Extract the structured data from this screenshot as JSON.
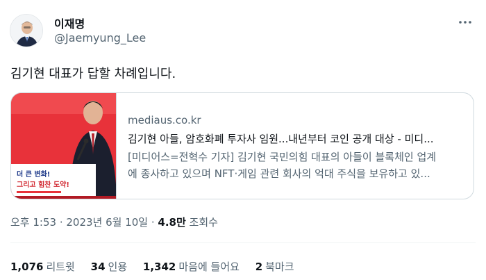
{
  "author": {
    "display_name": "이재명",
    "handle": "@Jaemyung_Lee"
  },
  "tweet": {
    "text": "김기현 대표가 답할 차례입니다."
  },
  "link_card": {
    "domain": "mediaus.co.kr",
    "title": "김기현 아들, 암호화폐 투자사 임원...내년부터 코인 공개 대상 - 미디...",
    "description_line1": "[미디어스=전혁수 기자] 김기현 국민의힘 대표의 아들이 블록체인 업계",
    "description_line2": "에 종사하고 있으며 NFT·게임 관련 회사의 억대 주식을 보유하고 있...",
    "image_banner_line1": "더 큰 변화!",
    "image_banner_line2": "그리고 힘찬 도약!"
  },
  "meta": {
    "time_date": "오후 1:53 · 2023년 6월 10일 · ",
    "views_count": "4.8만",
    "views_label": " 조회수"
  },
  "stats": [
    {
      "count": "1,076",
      "label": "리트윗"
    },
    {
      "count": "34",
      "label": "인용"
    },
    {
      "count": "1,342",
      "label": "마음에 들어요"
    },
    {
      "count": "2",
      "label": "북마크"
    }
  ],
  "colors": {
    "text_primary": "#0f1419",
    "text_secondary": "#536471",
    "border": "#cfd9de",
    "thumb_red": "#e8323a"
  },
  "icons": {
    "more": "more-dots-icon"
  }
}
